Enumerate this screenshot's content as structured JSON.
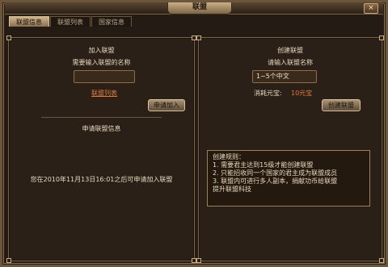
{
  "window": {
    "title": "联盟",
    "close_label": "×"
  },
  "tabs": [
    {
      "label": "联盟信息",
      "active": true
    },
    {
      "label": "联盟列表",
      "active": false
    },
    {
      "label": "国家信息",
      "active": false
    }
  ],
  "join": {
    "heading": "加入联盟",
    "prompt": "需要输入联盟的名称",
    "input_value": "",
    "list_link": "联盟列表",
    "apply_button": "申请加入",
    "info_heading": "申请联盟信息",
    "message": "您在2010年11月13日16:01之后可申请加入联盟"
  },
  "create": {
    "heading": "创建联盟",
    "prompt": "请输入联盟名称",
    "input_value": "1~5个中文",
    "cost_label": "消耗元宝:",
    "cost_value": "10元宝",
    "create_button": "创建联盟",
    "rules_title": "创建规则：",
    "rules": [
      "1. 需要君主达到15级才能创建联盟",
      "2. 只能招收同一个国家的君主成为联盟成员",
      "3. 联盟内可进行多人副本，捐献功币给联盟",
      "    提升联盟科技"
    ]
  },
  "colors": {
    "accent_link": "#e07a3c",
    "cost_value": "#e07a3c"
  }
}
